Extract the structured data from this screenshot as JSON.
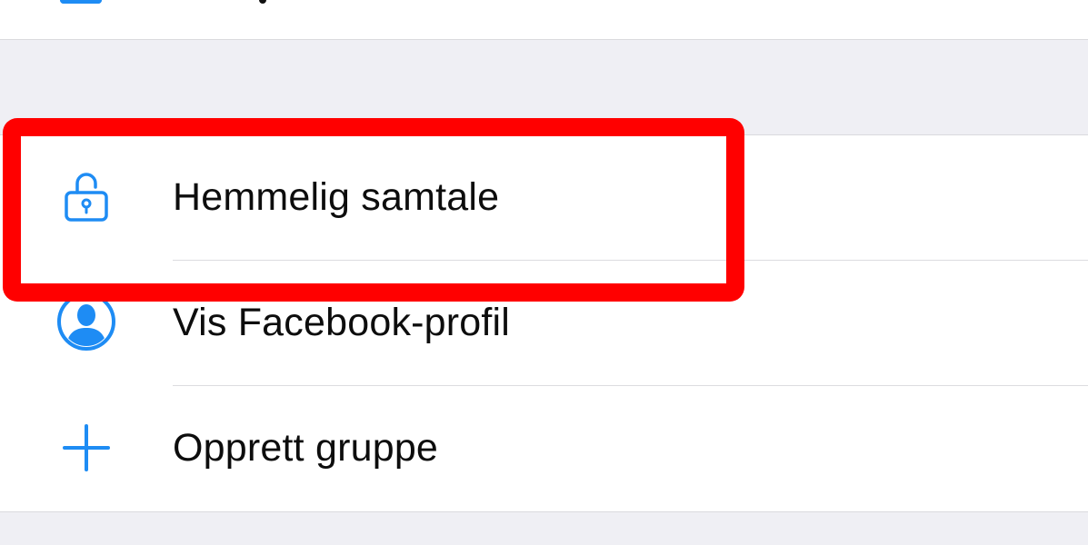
{
  "menu": {
    "items": [
      {
        "label": "Hemmelig samtale",
        "icon": "lock-icon"
      },
      {
        "label": "Vis Facebook-profil",
        "icon": "profile-icon"
      },
      {
        "label": "Opprett gruppe",
        "icon": "plus-icon"
      }
    ]
  },
  "colors": {
    "accent": "#1e8cf4",
    "highlight": "#ff0000",
    "background": "#efeff4",
    "cell": "#ffffff",
    "text": "#0d0d0d"
  }
}
